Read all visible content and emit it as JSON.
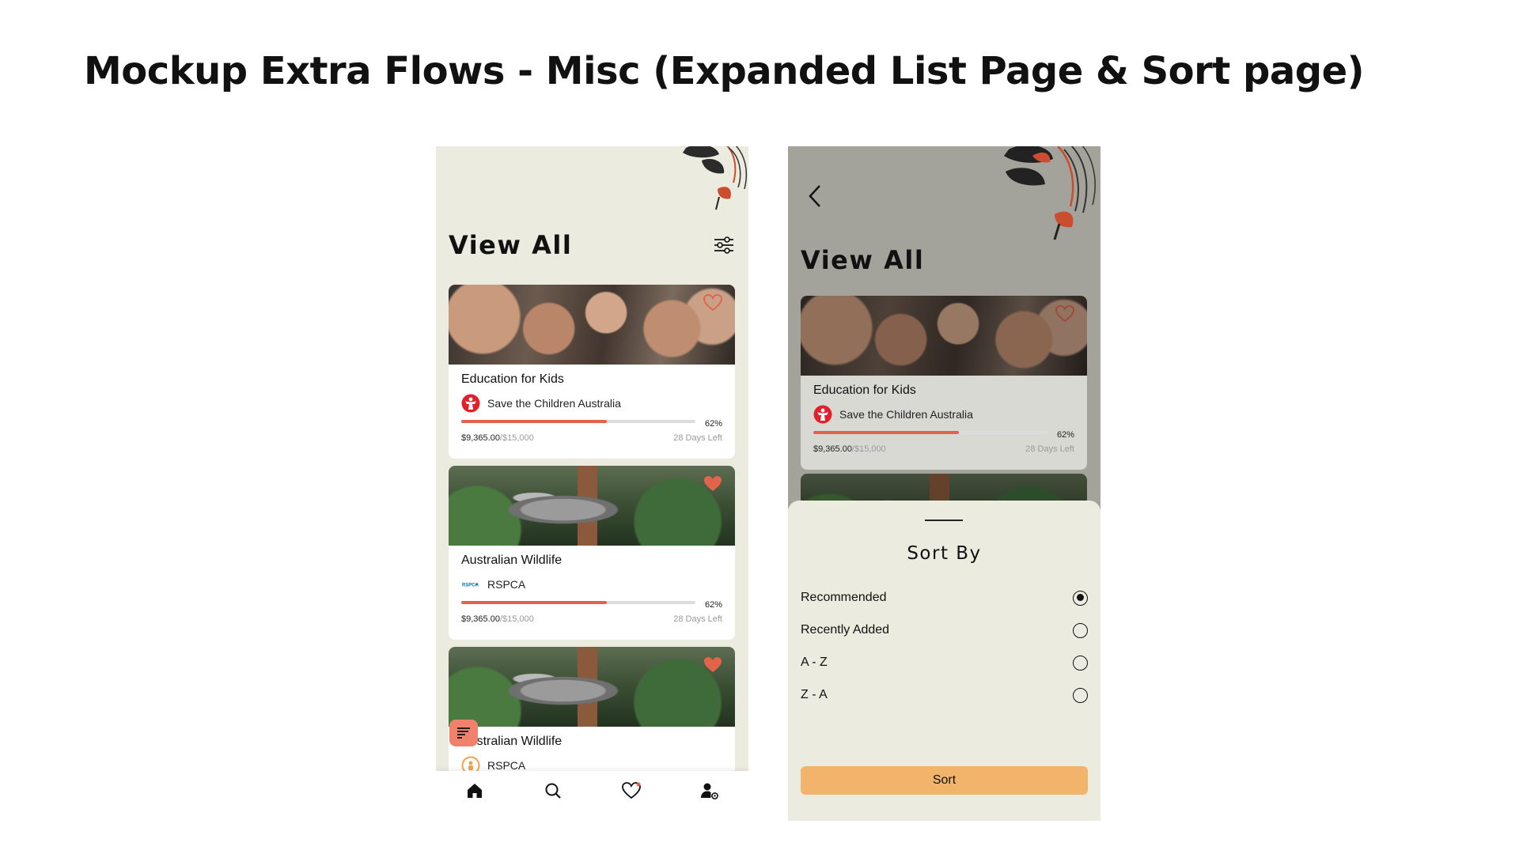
{
  "page": {
    "title": "Mockup Extra Flows - Misc (Expanded List Page & Sort page)"
  },
  "colors": {
    "screen_bg": "#ecebe0",
    "overlay_bg": "#a3a39b",
    "accent": "#e0634a",
    "sort_button": "#f2b46a",
    "fab": "#f0826d"
  },
  "list_screen": {
    "title": "View All",
    "filter_icon": "sliders-icon",
    "cards": [
      {
        "title": "Education for Kids",
        "org": "Save the Children Australia",
        "org_icon": "save-the-children-logo",
        "progress": 0.62,
        "percent_label": "62%",
        "raised": "$9,365.00",
        "goal": "/$15,000",
        "days_left": "28 Days Left",
        "favorited": false
      },
      {
        "title": "Australian Wildlife",
        "org": "RSPCA",
        "org_icon": "rspca-logo",
        "progress": 0.62,
        "percent_label": "62%",
        "raised": "$9,365.00",
        "goal": "/$15,000",
        "days_left": "28 Days Left",
        "favorited": true
      },
      {
        "title": "Australian Wildlife",
        "org": "RSPCA",
        "org_icon": "charity-logo",
        "favorited": true
      }
    ],
    "nav": [
      "home-icon",
      "search-icon",
      "heart-icon",
      "profile-settings-icon"
    ]
  },
  "sort_screen": {
    "title": "View All",
    "card": {
      "title": "Education for Kids",
      "org": "Save the Children Australia",
      "progress": 0.62,
      "percent_label": "62%",
      "raised": "$9,365.00",
      "goal": "/$15,000",
      "days_left": "28 Days Left"
    },
    "sheet": {
      "title": "Sort By",
      "options": [
        {
          "label": "Recommended",
          "selected": true
        },
        {
          "label": "Recently Added",
          "selected": false
        },
        {
          "label": "A - Z",
          "selected": false
        },
        {
          "label": "Z - A",
          "selected": false
        }
      ],
      "button": "Sort"
    }
  }
}
